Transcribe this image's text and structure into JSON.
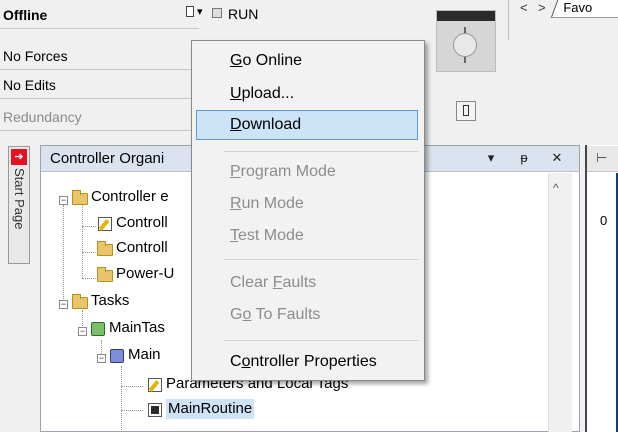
{
  "status": {
    "mode": "Offline",
    "forces": "No Forces",
    "edits": "No Edits",
    "redundancy": "Redundancy",
    "run_label": "RUN"
  },
  "favorites": {
    "nav_back": "<",
    "nav_forward": ">",
    "tab_label": "Favo"
  },
  "start_page": {
    "label": "Start Page"
  },
  "organizer": {
    "title": "Controller Organi",
    "btn_dropdown": "▾",
    "btn_pin": "ᵽ",
    "btn_close": "✕",
    "scroll_up": "^",
    "tree": {
      "controller": "Controller e",
      "controller_tags": "Controll",
      "controller_fault": "Controll",
      "power_up": "Power-U",
      "tasks": "Tasks",
      "main_task": "MainTas",
      "main_program": "Main",
      "params": "Parameters and Local Tags",
      "main_routine": "MainRoutine"
    }
  },
  "editor": {
    "rung_number": "0"
  },
  "menu": {
    "items": [
      {
        "pre": "",
        "acc": "G",
        "post": "o Online",
        "disabled": false
      },
      {
        "pre": "",
        "acc": "U",
        "post": "pload...",
        "disabled": false
      },
      {
        "pre": "",
        "acc": "D",
        "post": "ownload",
        "disabled": false,
        "highlighted": true
      },
      {
        "pre": "",
        "acc": "P",
        "post": "rogram Mode",
        "disabled": true
      },
      {
        "pre": "",
        "acc": "R",
        "post": "un Mode",
        "disabled": true
      },
      {
        "pre": "",
        "acc": "T",
        "post": "est Mode",
        "disabled": true
      },
      {
        "pre": "Clear ",
        "acc": "F",
        "post": "aults",
        "disabled": true
      },
      {
        "pre": "G",
        "acc": "o",
        "post": " To Faults",
        "disabled": true
      },
      {
        "pre": "C",
        "acc": "o",
        "post": "ntroller Properties",
        "disabled": false
      }
    ]
  },
  "colors": {
    "menu_highlight": "#cce4f7",
    "menu_highlight_border": "#5b9bd5",
    "organizer_header": "#dbe3ef",
    "selection": "#cfe3f6",
    "start_page_icon": "#e81123"
  }
}
